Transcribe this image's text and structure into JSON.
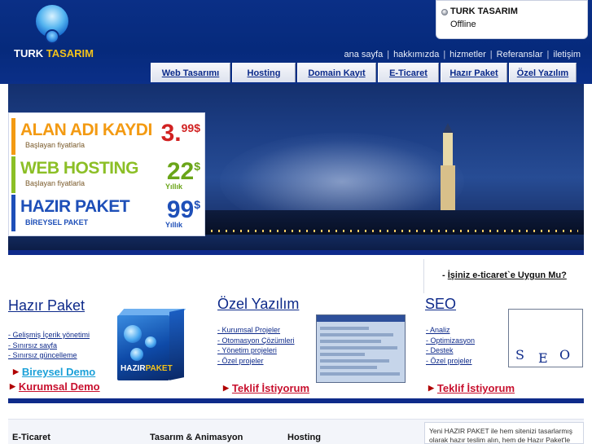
{
  "brand": {
    "word1": "TURK",
    "word2": "TASARIM",
    "accent": "#f3c21b",
    "primary": "#0e2a8a"
  },
  "status": {
    "name": "TURK TASARIM",
    "state": "Offline"
  },
  "top_nav": [
    "ana sayfa",
    "hakkımızda",
    "hizmetler",
    "Referanslar",
    "iletişim"
  ],
  "tabs": [
    "Web Tasarımı",
    "Hosting",
    "Domain Kayıt",
    "E-Ticaret",
    "Hazır Paket",
    "Özel Yazılım"
  ],
  "promos": [
    {
      "name": "ALAN ADI KAYDI",
      "sub": "Başlayan fiyatlarla",
      "price": "3.",
      "decimal": "99$",
      "per": "",
      "color": "#f39a12"
    },
    {
      "name": "WEB HOSTING",
      "sub": "Başlayan fiyatlarla",
      "price": "22",
      "decimal": "$",
      "per": "Yıllık",
      "color": "#8cbf26"
    },
    {
      "name": "HAZIR PAKET",
      "sub": "BİREYSEL PAKET",
      "price": "99",
      "decimal": "$",
      "per": "Yıllık",
      "color": "#1e4fb8"
    }
  ],
  "question": {
    "prefix": "- ",
    "link": "İşiniz e-ticaret`e Uygun Mu?"
  },
  "hazir": {
    "title": "Hazır Paket",
    "items": [
      "- Gelişmiş İçerik yönetimi",
      "- Sınırsız sayfa",
      "- Sınırsız güncelleme"
    ],
    "demo1": "Bireysel Demo",
    "demo2": "Kurumsal Demo",
    "box_word1": "HAZIR",
    "box_word2": "PAKET"
  },
  "ozel": {
    "title": "Özel Yazılım",
    "items": [
      "- Kurumsal Projeler",
      "- Otomasyon Çözümleri",
      "- Yönetim projeleri",
      "- Özel projeler"
    ],
    "cta": "Teklif İstiyorum"
  },
  "seo": {
    "title": "SEO",
    "items": [
      "- Analiz",
      "- Optimizasyon",
      "- Destek",
      "- Özel projeler"
    ],
    "cta": "Teklif İstiyorum",
    "letters": [
      "S",
      "E",
      "O"
    ]
  },
  "footer": {
    "headings": [
      "E-Ticaret",
      "Tasarım & Animasyon",
      "Hosting"
    ],
    "note": "Yeni HAZIR PAKET ile hem sitenizi tasarlarmış olarak hazır teslim alın, hem de Hazır Paket'le"
  }
}
